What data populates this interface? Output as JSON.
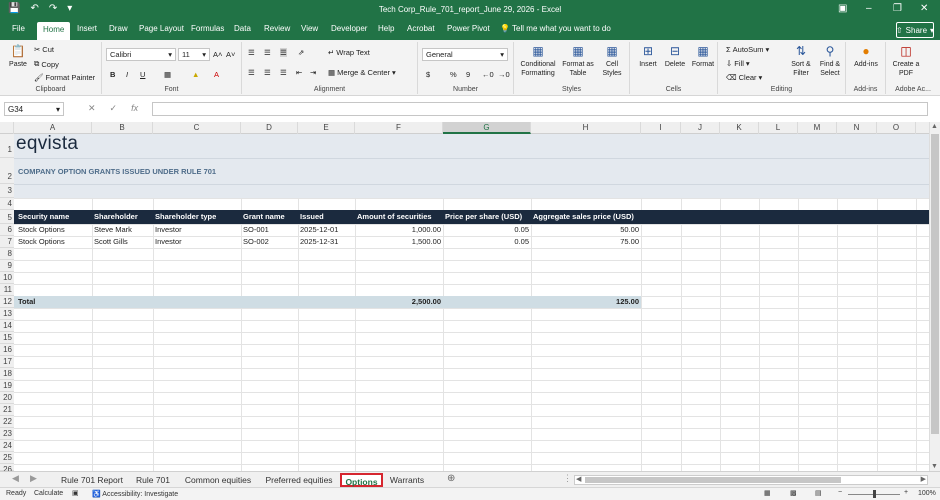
{
  "window": {
    "title": "Tech Corp_Rule_701_report_June 29, 2026  -  Excel",
    "qat_icons": [
      "save-icon",
      "undo-icon",
      "redo-icon",
      "customize-qat-icon"
    ],
    "controls": [
      "ribbon-display-icon",
      "minimize-icon",
      "restore-icon",
      "close-icon"
    ]
  },
  "ribbon_tabs": [
    "File",
    "Home",
    "Insert",
    "Draw",
    "Page Layout",
    "Formulas",
    "Data",
    "Review",
    "View",
    "Developer",
    "Help",
    "Acrobat",
    "Power Pivot"
  ],
  "active_ribbon_tab": "Home",
  "tell_me": "Tell me what you want to do",
  "share_label": "Share",
  "ribbon": {
    "clipboard": {
      "label": "Clipboard",
      "paste": "Paste",
      "cut": "Cut",
      "copy": "Copy",
      "format_painter": "Format Painter"
    },
    "font": {
      "label": "Font",
      "name": "Calibri",
      "size": "11",
      "bold": "B",
      "italic": "I",
      "underline": "U"
    },
    "alignment": {
      "label": "Alignment",
      "wrap": "Wrap Text",
      "merge": "Merge & Center"
    },
    "number": {
      "label": "Number",
      "format": "General",
      "currency": "$",
      "percent": "%",
      "comma": "9"
    },
    "styles": {
      "label": "Styles",
      "conditional": "Conditional Formatting",
      "format_table": "Format as Table",
      "cell_styles": "Cell Styles"
    },
    "cells": {
      "label": "Cells",
      "insert": "Insert",
      "delete": "Delete",
      "format": "Format"
    },
    "editing": {
      "label": "Editing",
      "autosum": "AutoSum",
      "fill": "Fill",
      "clear": "Clear",
      "sort": "Sort & Filter",
      "find": "Find & Select"
    },
    "addins": {
      "label": "Add-ins",
      "addins": "Add-ins"
    },
    "adobe": {
      "label": "Adobe Ac...",
      "create_pdf": "Create a PDF"
    }
  },
  "formula_bar": {
    "name_box": "G34",
    "cancel": "✕",
    "enter": "✓",
    "fx": "fx",
    "formula": ""
  },
  "columns": [
    "A",
    "B",
    "C",
    "D",
    "E",
    "F",
    "G",
    "H",
    "I",
    "J",
    "K",
    "L",
    "M",
    "N",
    "O"
  ],
  "selected_column": "G",
  "rows": [
    "1",
    "2",
    "3",
    "4",
    "5",
    "6",
    "7",
    "8",
    "9",
    "10",
    "11",
    "12",
    "13",
    "14",
    "15",
    "16",
    "17",
    "18",
    "19",
    "20",
    "21",
    "22",
    "23",
    "24",
    "25",
    "26"
  ],
  "sheet": {
    "logo": "eqvista",
    "subtitle": "COMPANY OPTION GRANTS ISSUED UNDER RULE 701",
    "headers": [
      "Security name",
      "Shareholder",
      "Shareholder type",
      "Grant name",
      "Issued",
      "Amount of securities",
      "Price per share (USD)",
      "Aggregate sales price (USD)"
    ],
    "data_rows": [
      [
        "Stock Options",
        "Steve Mark",
        "Investor",
        "SO-001",
        "2025-12-01",
        "1,000.00",
        "0.05",
        "50.00"
      ],
      [
        "Stock Options",
        "Scott Gills",
        "Investor",
        "SO-002",
        "2025-12-31",
        "1,500.00",
        "0.05",
        "75.00"
      ]
    ],
    "total": {
      "label": "Total",
      "amount": "2,500.00",
      "aggregate": "125.00"
    },
    "colors": {
      "header_bg": "#1b2a3e",
      "band_bg": "#e4e9ef",
      "total_bg": "#cfdde4",
      "title_color": "#4f6d8a"
    }
  },
  "sheet_tabs": [
    "Rule 701 Report",
    "Rule 701",
    "Common equities",
    "Preferred equities",
    "Options",
    "Warrants"
  ],
  "active_sheet": "Options",
  "status": {
    "ready": "Ready",
    "calculate": "Calculate",
    "accessibility": "Accessibility: Investigate",
    "zoom": "100%"
  }
}
